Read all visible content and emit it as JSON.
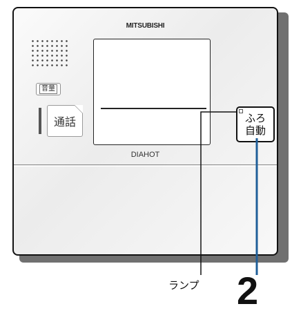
{
  "panel": {
    "brand": "MITSUBISHI",
    "model": "DIAHOT",
    "volume_button": "音量",
    "call_button": "通話",
    "bath_button": {
      "line1": "ふろ",
      "line2": "自動"
    }
  },
  "callouts": {
    "lamp_label": "ランプ",
    "number": "2"
  },
  "colors": {
    "shadow": "#707070",
    "leader_blue": "#1f5f99",
    "outline": "#111111"
  }
}
